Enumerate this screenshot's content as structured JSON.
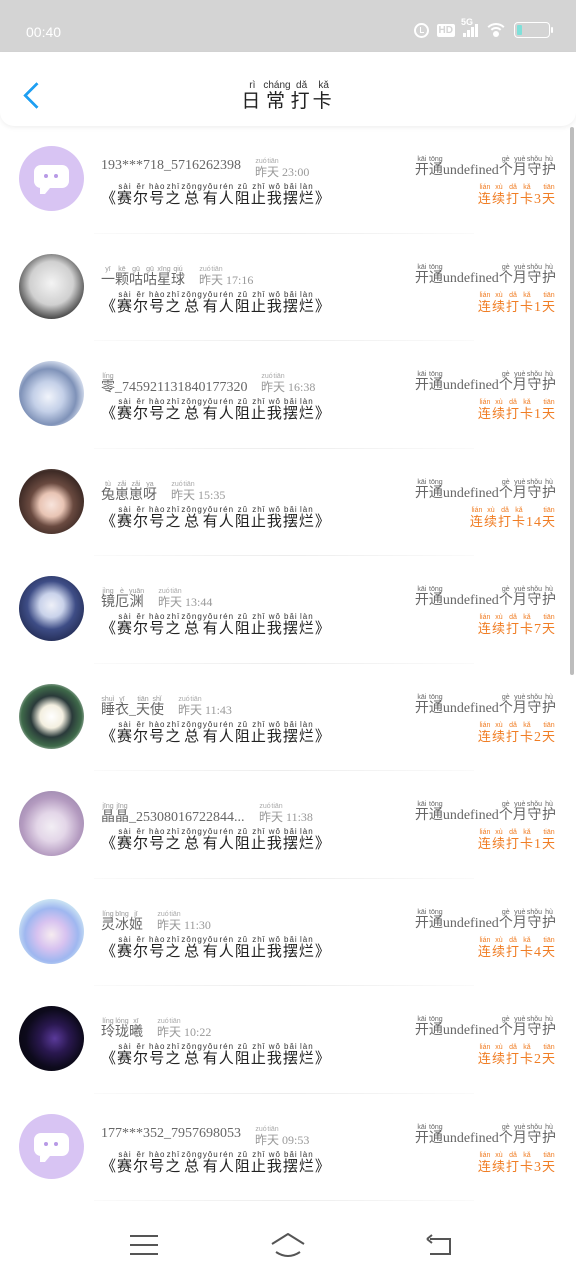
{
  "status_bar": {
    "time": "00:40",
    "icons": [
      "alarm-icon",
      "hd-icon",
      "signal-5g-icon",
      "wifi-icon",
      "battery-icon"
    ],
    "hd_label": "HD",
    "network_label": "5G",
    "battery_level": 0.15
  },
  "header": {
    "back_icon": "chevron-left-icon",
    "title": [
      {
        "c": "日",
        "p": "rì"
      },
      {
        "c": "常",
        "p": "cháng"
      },
      {
        "c": "打",
        "p": "dǎ"
      },
      {
        "c": "卡",
        "p": "kǎ"
      }
    ]
  },
  "colors": {
    "accent": "#1e9ff2",
    "streak": "#f07d24",
    "default_avatar": "#d8c4f3"
  },
  "channel": [
    {
      "c": "《",
      "p": ""
    },
    {
      "c": "赛",
      "p": "sài"
    },
    {
      "c": "尔",
      "p": "ěr"
    },
    {
      "c": "号",
      "p": "hào"
    },
    {
      "c": "之",
      "p": "zhī"
    },
    {
      "c": "总",
      "p": "zǒng"
    },
    {
      "c": "有",
      "p": "yǒu"
    },
    {
      "c": "人",
      "p": "rén"
    },
    {
      "c": "阻",
      "p": "zǔ"
    },
    {
      "c": "止",
      "p": "zhǐ"
    },
    {
      "c": "我",
      "p": "wǒ"
    },
    {
      "c": "摆",
      "p": "bǎi"
    },
    {
      "c": "烂",
      "p": "làn"
    },
    {
      "c": "》",
      "p": ""
    }
  ],
  "subscription": {
    "prefix": [
      {
        "c": "开",
        "p": "kāi"
      },
      {
        "c": "通",
        "p": "tōng"
      }
    ],
    "value": "undefined",
    "suffix": [
      {
        "c": "个",
        "p": "gè"
      },
      {
        "c": "月",
        "p": "yuè"
      },
      {
        "c": "守",
        "p": "shǒu"
      },
      {
        "c": "护",
        "p": "hù"
      }
    ]
  },
  "streak_words": {
    "prefix": [
      {
        "c": "连",
        "p": "lián"
      },
      {
        "c": "续",
        "p": "xù"
      },
      {
        "c": "打",
        "p": "dǎ"
      },
      {
        "c": "卡",
        "p": "kǎ"
      }
    ],
    "suffix": [
      {
        "c": "天",
        "p": "tiān"
      }
    ]
  },
  "time_prefix": [
    {
      "c": "昨",
      "p": "zuó"
    },
    {
      "c": "天",
      "p": "tiān"
    }
  ],
  "records": [
    {
      "avatar": "default-chat-avatar",
      "name": [
        {
          "c": "193***718_5716262398",
          "p": ""
        }
      ],
      "time": "23:00",
      "streak_days": "3"
    },
    {
      "avatar": "sketch-avatar",
      "name": [
        {
          "c": "一",
          "p": "yī"
        },
        {
          "c": "颗",
          "p": "kē"
        },
        {
          "c": "咕",
          "p": "gū"
        },
        {
          "c": "咕",
          "p": "gū"
        },
        {
          "c": "星",
          "p": "xīng"
        },
        {
          "c": "球",
          "p": "qiú"
        }
      ],
      "time": "17:16",
      "streak_days": "1"
    },
    {
      "avatar": "anime-blue-avatar",
      "name": [
        {
          "c": "零",
          "p": "líng"
        },
        {
          "c": "_745921131840177320",
          "p": ""
        }
      ],
      "time": "16:38",
      "streak_days": "1"
    },
    {
      "avatar": "anime-girl-avatar",
      "name": [
        {
          "c": "兔",
          "p": "tù"
        },
        {
          "c": "崽",
          "p": "zǎi"
        },
        {
          "c": "崽",
          "p": "zǎi"
        },
        {
          "c": "呀",
          "p": "ya"
        }
      ],
      "time": "15:35",
      "streak_days": "14"
    },
    {
      "avatar": "anime-longhair-avatar",
      "name": [
        {
          "c": "镜",
          "p": "jìng"
        },
        {
          "c": "厄",
          "p": "è"
        },
        {
          "c": "渊",
          "p": "yuān"
        }
      ],
      "time": "13:44",
      "streak_days": "7"
    },
    {
      "avatar": "anime-green-avatar",
      "name": [
        {
          "c": "睡",
          "p": "shuì"
        },
        {
          "c": "衣",
          "p": "yī"
        },
        {
          "c": "_",
          "p": ""
        },
        {
          "c": "天",
          "p": "tiān"
        },
        {
          "c": "使",
          "p": "shǐ"
        }
      ],
      "time": "11:43",
      "streak_days": "2"
    },
    {
      "avatar": "anime-lilac-avatar",
      "name": [
        {
          "c": "晶",
          "p": "jīng"
        },
        {
          "c": "晶",
          "p": "jīng"
        },
        {
          "c": "_25308016722844...",
          "p": ""
        }
      ],
      "time": "11:38",
      "streak_days": "1"
    },
    {
      "avatar": "anime-crystal-avatar",
      "name": [
        {
          "c": "灵",
          "p": "líng"
        },
        {
          "c": "冰",
          "p": "bīng"
        },
        {
          "c": "姬",
          "p": "jī"
        }
      ],
      "time": "11:30",
      "streak_days": "4"
    },
    {
      "avatar": "dark-purple-avatar",
      "name": [
        {
          "c": "玲",
          "p": "líng"
        },
        {
          "c": "珑",
          "p": "lóng"
        },
        {
          "c": "曦",
          "p": "xī"
        }
      ],
      "time": "10:22",
      "streak_days": "2"
    },
    {
      "avatar": "default-chat-avatar",
      "name": [
        {
          "c": "177***352_7957698053",
          "p": ""
        }
      ],
      "time": "09:53",
      "streak_days": "3"
    }
  ],
  "navbar": {
    "icons": [
      "menu-icon",
      "home-icon",
      "back-icon"
    ]
  }
}
